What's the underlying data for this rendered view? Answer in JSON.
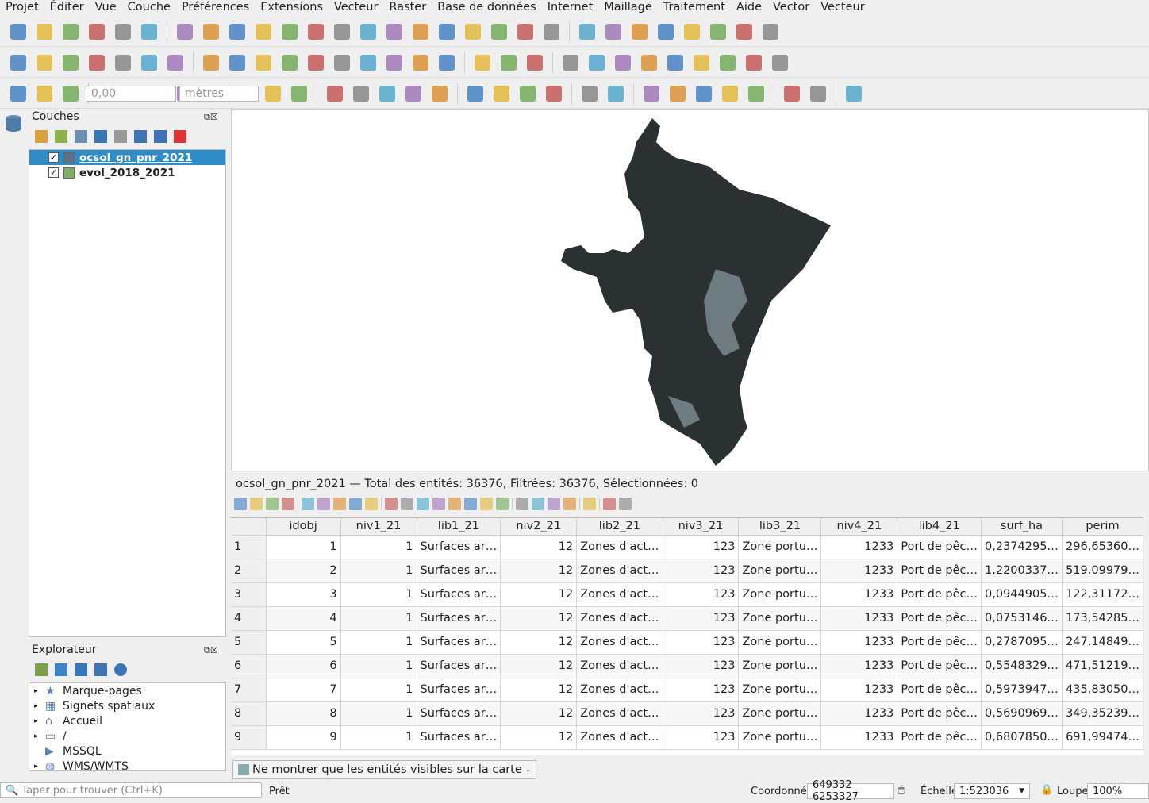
{
  "menu": [
    "Projet",
    "Éditer",
    "Vue",
    "Couche",
    "Préférences",
    "Extensions",
    "Vecteur",
    "Raster",
    "Base de données",
    "Internet",
    "Maillage",
    "Traitement",
    "Aide",
    "Vector",
    "Vecteur"
  ],
  "toolbars": {
    "row1": [
      "new-project",
      "open-project",
      "save-project",
      "save-as",
      "print-layout",
      "style-manager",
      "|",
      "pan",
      "pan-to-selection",
      "zoom-in",
      "zoom-out",
      "zoom-full",
      "zoom-selection",
      "zoom-layer",
      "zoom-native",
      "zoom-last",
      "zoom-next",
      "new-bookmark",
      "show-bookmarks",
      "new-map-view",
      "temporal",
      "refresh",
      "|",
      "identify",
      "attribute-table",
      "select-features",
      "statistics",
      "field-calculator",
      "measure",
      "map-tips",
      "locator"
    ],
    "row2": [
      "add-vector",
      "add-raster",
      "digitize",
      "edit-pen",
      "add-wms",
      "add-mesh",
      "new-layer",
      "|",
      "toggle-edit",
      "save-edits",
      "add-feature",
      "vertex-tool",
      "delete",
      "cut",
      "copy",
      "paste",
      "undo",
      "redo",
      "|",
      "select",
      "deselect",
      "select-by-expression",
      "|",
      "label-abc",
      "label-pin",
      "label-abc2",
      "label-red",
      "label-show",
      "label-move",
      "label-rotate",
      "label-change",
      "label-settings"
    ],
    "row3": [
      "snapping",
      "snap-options",
      "snap-grid",
      "|",
      "trace",
      "avoid",
      "cross",
      "cut-edge",
      "topology",
      "|",
      "globe-1",
      "globe-2",
      "globe-3",
      "|",
      "python",
      "wkt",
      "plugin-save",
      "undo-plugin",
      "rocket",
      "|",
      "qgis-box",
      "gear",
      "add-box",
      "sync",
      "|",
      "plugin-green",
      "plugin-yellow",
      "|",
      "db",
      "arrow",
      "search",
      "help-select",
      "pdf",
      "|",
      "scissors",
      "help",
      "|",
      "db-yellow"
    ]
  },
  "snapping": {
    "tolerance": "0,00",
    "unit": "mètres"
  },
  "layers_panel": {
    "title": "Couches",
    "layers": [
      {
        "name": "ocsol_gn_pnr_2021",
        "checked": true,
        "selected": true,
        "color": "#5c7286"
      },
      {
        "name": "evol_2018_2021",
        "checked": true,
        "selected": false,
        "color": "#7fb069"
      }
    ]
  },
  "explorer_panel": {
    "title": "Explorateur",
    "items": [
      "Marque-pages",
      "Signets spatiaux",
      "Accueil",
      "/",
      "MSSQL",
      "WMS/WMTS"
    ]
  },
  "map": {
    "fill": "#2b3032",
    "water": "#6e7b80"
  },
  "attribute_table": {
    "title": "ocsol_gn_pnr_2021 — Total des entités: 36376, Filtrées: 36376, Sélectionnées: 0",
    "columns": [
      "idobj",
      "niv1_21",
      "lib1_21",
      "niv2_21",
      "lib2_21",
      "niv3_21",
      "lib3_21",
      "niv4_21",
      "lib4_21",
      "surf_ha",
      "perim"
    ],
    "rows": [
      [
        "1",
        "1",
        "1",
        "Surfaces ar…",
        "12",
        "Zones d'act…",
        "123",
        "Zone portu…",
        "1233",
        "Port de pêc…",
        "0,2374295…",
        "296,65360…"
      ],
      [
        "2",
        "2",
        "1",
        "Surfaces ar…",
        "12",
        "Zones d'act…",
        "123",
        "Zone portu…",
        "1233",
        "Port de pêc…",
        "1,2200337…",
        "519,09979…"
      ],
      [
        "3",
        "3",
        "1",
        "Surfaces ar…",
        "12",
        "Zones d'act…",
        "123",
        "Zone portu…",
        "1233",
        "Port de pêc…",
        "0,0944905…",
        "122,31172…"
      ],
      [
        "4",
        "4",
        "1",
        "Surfaces ar…",
        "12",
        "Zones d'act…",
        "123",
        "Zone portu…",
        "1233",
        "Port de pêc…",
        "0,0753146…",
        "173,54285…"
      ],
      [
        "5",
        "5",
        "1",
        "Surfaces ar…",
        "12",
        "Zones d'act…",
        "123",
        "Zone portu…",
        "1233",
        "Port de pêc…",
        "0,2787095…",
        "247,14849…"
      ],
      [
        "6",
        "6",
        "1",
        "Surfaces ar…",
        "12",
        "Zones d'act…",
        "123",
        "Zone portu…",
        "1233",
        "Port de pêc…",
        "0,5548329…",
        "471,51219…"
      ],
      [
        "7",
        "7",
        "1",
        "Surfaces ar…",
        "12",
        "Zones d'act…",
        "123",
        "Zone portu…",
        "1233",
        "Port de pêc…",
        "0,5973947…",
        "435,83050…"
      ],
      [
        "8",
        "8",
        "1",
        "Surfaces ar…",
        "12",
        "Zones d'act…",
        "123",
        "Zone portu…",
        "1233",
        "Port de pêc…",
        "0,5690969…",
        "349,35239…"
      ],
      [
        "9",
        "9",
        "1",
        "Surfaces ar…",
        "12",
        "Zones d'act…",
        "123",
        "Zone portu…",
        "1233",
        "Port de pêc…",
        "0,6807850…",
        "691,99474…"
      ]
    ],
    "filter_label": "Ne montrer que les entités visibles sur la carte"
  },
  "statusbar": {
    "search_placeholder": "Taper pour trouver (Ctrl+K)",
    "status": "Prêt",
    "coord_label": "Coordonnée",
    "coord": "649332 6253327",
    "scale_label": "Échelle",
    "scale": "1:523036",
    "magnifier_label": "Loupe",
    "magnifier": "100%"
  }
}
